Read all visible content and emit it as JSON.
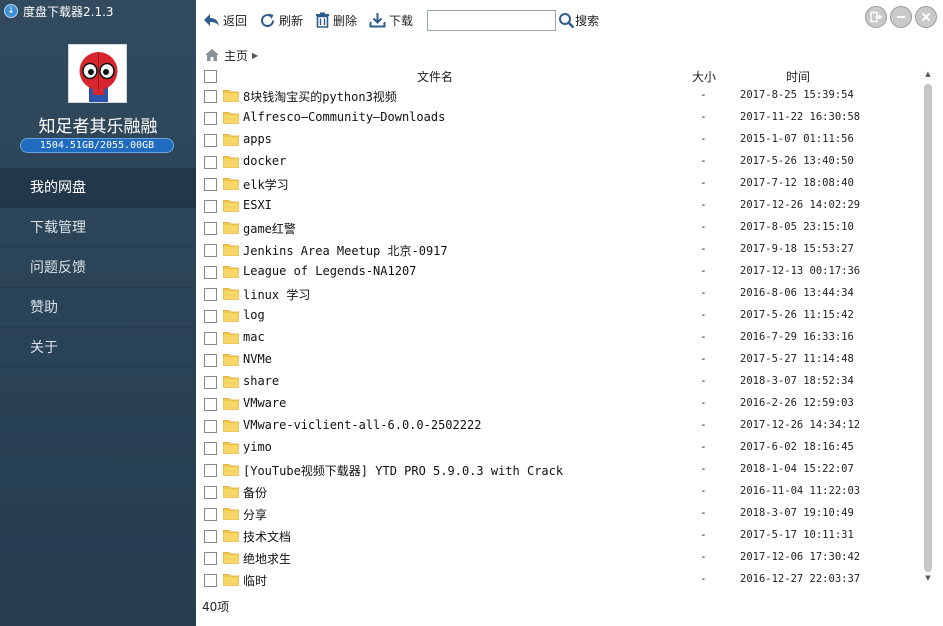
{
  "app": {
    "title": "度盘下载器2.1.3"
  },
  "user": {
    "name": "知足者其乐融融",
    "quota": "1504.51GB/2055.00GB"
  },
  "nav": [
    {
      "label": "我的网盘",
      "active": true
    },
    {
      "label": "下载管理"
    },
    {
      "label": "问题反馈"
    },
    {
      "label": "赞助"
    },
    {
      "label": "关于"
    }
  ],
  "toolbar": {
    "back_label": "返回",
    "refresh_label": "刷新",
    "delete_label": "删除",
    "download_label": "下载",
    "search_value": "",
    "search_label": "搜索"
  },
  "breadcrumb": {
    "home": "主页"
  },
  "table": {
    "headers": {
      "name": "文件名",
      "size": "大小",
      "time": "时间"
    },
    "rows": [
      {
        "name": "8块钱淘宝买的python3视频",
        "size": "-",
        "time": "2017-8-25 15:39:54"
      },
      {
        "name": "Alfresco—Community—Downloads",
        "size": "-",
        "time": "2017-11-22 16:30:58"
      },
      {
        "name": "apps",
        "size": "-",
        "time": "2015-1-07 01:11:56"
      },
      {
        "name": "docker",
        "size": "-",
        "time": "2017-5-26 13:40:50"
      },
      {
        "name": "elk学习",
        "size": "-",
        "time": "2017-7-12 18:08:40"
      },
      {
        "name": "ESXI",
        "size": "-",
        "time": "2017-12-26 14:02:29"
      },
      {
        "name": "game红警",
        "size": "-",
        "time": "2017-8-05 23:15:10"
      },
      {
        "name": "Jenkins Area Meetup 北京-0917",
        "size": "-",
        "time": "2017-9-18 15:53:27"
      },
      {
        "name": "League of Legends-NA1207",
        "size": "-",
        "time": "2017-12-13 00:17:36"
      },
      {
        "name": "linux 学习",
        "size": "-",
        "time": "2016-8-06 13:44:34"
      },
      {
        "name": "log",
        "size": "-",
        "time": "2017-5-26 11:15:42"
      },
      {
        "name": "mac",
        "size": "-",
        "time": "2016-7-29 16:33:16"
      },
      {
        "name": "NVMe",
        "size": "-",
        "time": "2017-5-27 11:14:48"
      },
      {
        "name": "share",
        "size": "-",
        "time": "2018-3-07 18:52:34"
      },
      {
        "name": "VMware",
        "size": "-",
        "time": "2016-2-26 12:59:03"
      },
      {
        "name": "VMware-viclient-all-6.0.0-2502222",
        "size": "-",
        "time": "2017-12-26 14:34:12"
      },
      {
        "name": "yimo",
        "size": "-",
        "time": "2017-6-02 18:16:45"
      },
      {
        "name": "[YouTube视频下载器] YTD PRO 5.9.0.3  with Crack",
        "size": "-",
        "time": "2018-1-04 15:22:07"
      },
      {
        "name": "备份",
        "size": "-",
        "time": "2016-11-04 11:22:03"
      },
      {
        "name": "分享",
        "size": "-",
        "time": "2018-3-07 19:10:49"
      },
      {
        "name": "技术文档",
        "size": "-",
        "time": "2017-5-17 10:11:31"
      },
      {
        "name": "绝地求生",
        "size": "-",
        "time": "2017-12-06 17:30:42"
      },
      {
        "name": "临时",
        "size": "-",
        "time": "2016-12-27 22:03:37"
      }
    ]
  },
  "status": {
    "count": "40项"
  },
  "colors": {
    "sidebar": "#2c4457",
    "quota_bar": "#1f6bc0",
    "folder": "#f5c94c"
  }
}
